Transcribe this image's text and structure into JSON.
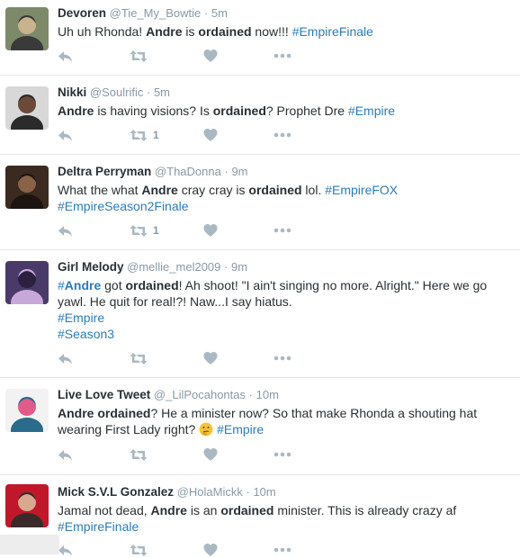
{
  "tweets": [
    {
      "fullname": "Devoren",
      "username": "@Tie_My_Bowtie",
      "time": "5m",
      "segments": [
        {
          "t": "Uh uh Rhonda! "
        },
        {
          "t": "Andre",
          "b": true
        },
        {
          "t": " is "
        },
        {
          "t": "ordained",
          "b": true
        },
        {
          "t": " now!!! "
        },
        {
          "t": "#EmpireFinale",
          "tag": true
        }
      ],
      "retweets": "",
      "likes": "",
      "avatar_colors": [
        "#7d8a6a",
        "#3a3a3a",
        "#c9b28e"
      ]
    },
    {
      "fullname": "Nikki",
      "username": "@Soulrific",
      "time": "5m",
      "segments": [
        {
          "t": "Andre",
          "b": true
        },
        {
          "t": " is having visions? Is "
        },
        {
          "t": "ordained",
          "b": true
        },
        {
          "t": "? Prophet Dre "
        },
        {
          "t": "#Empire",
          "tag": true
        }
      ],
      "retweets": "1",
      "likes": "",
      "avatar_colors": [
        "#d8d8d8",
        "#2b2b2b",
        "#6b4a3a"
      ]
    },
    {
      "fullname": "Deltra Perryman",
      "username": "@ThaDonna",
      "time": "9m",
      "segments": [
        {
          "t": "What the what "
        },
        {
          "t": "Andre",
          "b": true
        },
        {
          "t": " cray cray is "
        },
        {
          "t": "ordained",
          "b": true
        },
        {
          "t": " lol.  "
        },
        {
          "t": "#EmpireFOX",
          "tag": true
        },
        {
          "br": true
        },
        {
          "t": "#EmpireSeason2Finale",
          "tag": true
        }
      ],
      "retweets": "1",
      "likes": "",
      "avatar_colors": [
        "#3a2a20",
        "#1c1410",
        "#8a6248"
      ]
    },
    {
      "fullname": "Girl Melody",
      "username": "@mellie_mel2009",
      "time": "9m",
      "segments": [
        {
          "t": "#",
          "tag": true
        },
        {
          "t": "Andre",
          "tag": true,
          "b": true
        },
        {
          "t": " got "
        },
        {
          "t": "ordained",
          "b": true
        },
        {
          "t": "! Ah shoot! \"I ain't singing no more. Alright.\" Here we go yawl. He quit for real!?! Naw...I say hiatus."
        },
        {
          "br": true
        },
        {
          "t": "#Empire",
          "tag": true
        },
        {
          "br": true
        },
        {
          "t": "#Season3",
          "tag": true
        }
      ],
      "retweets": "",
      "likes": "",
      "avatar_colors": [
        "#4a3a6a",
        "#c8a8d8",
        "#2a2040"
      ]
    },
    {
      "fullname": "Live Love Tweet",
      "username": "@_LilPocahontas",
      "time": "10m",
      "segments": [
        {
          "t": "Andre",
          "b": true
        },
        {
          "t": " "
        },
        {
          "t": "ordained",
          "b": true
        },
        {
          "t": "? He a minister now? So that make Rhonda a shouting hat wearing First Lady right? "
        },
        {
          "emoji": "thinking-face"
        },
        {
          "t": " "
        },
        {
          "t": "#Empire",
          "tag": true
        }
      ],
      "retweets": "",
      "likes": "",
      "avatar_colors": [
        "#f2f2f2",
        "#2a6a8a",
        "#e05a8a"
      ]
    },
    {
      "fullname": "Mick S.V.L Gonzalez",
      "username": "@HolaMickk",
      "time": "10m",
      "segments": [
        {
          "t": "Jamal not dead, "
        },
        {
          "t": "Andre",
          "b": true
        },
        {
          "t": " is an "
        },
        {
          "t": "ordained",
          "b": true
        },
        {
          "t": " minister. This is already crazy af"
        },
        {
          "br": true
        },
        {
          "t": "#EmpireFinale",
          "tag": true
        }
      ],
      "retweets": "",
      "likes": "",
      "avatar_colors": [
        "#c0182a",
        "#3a2a2a",
        "#d8a890"
      ]
    }
  ],
  "icons": {
    "reply": "reply-icon",
    "retweet": "retweet-icon",
    "like": "heart-icon",
    "more": "more-icon"
  },
  "colors": {
    "link": "#2b7bb9",
    "meta": "#8899a6",
    "icon": "#aab8c2",
    "divider": "#e1e8ed"
  }
}
